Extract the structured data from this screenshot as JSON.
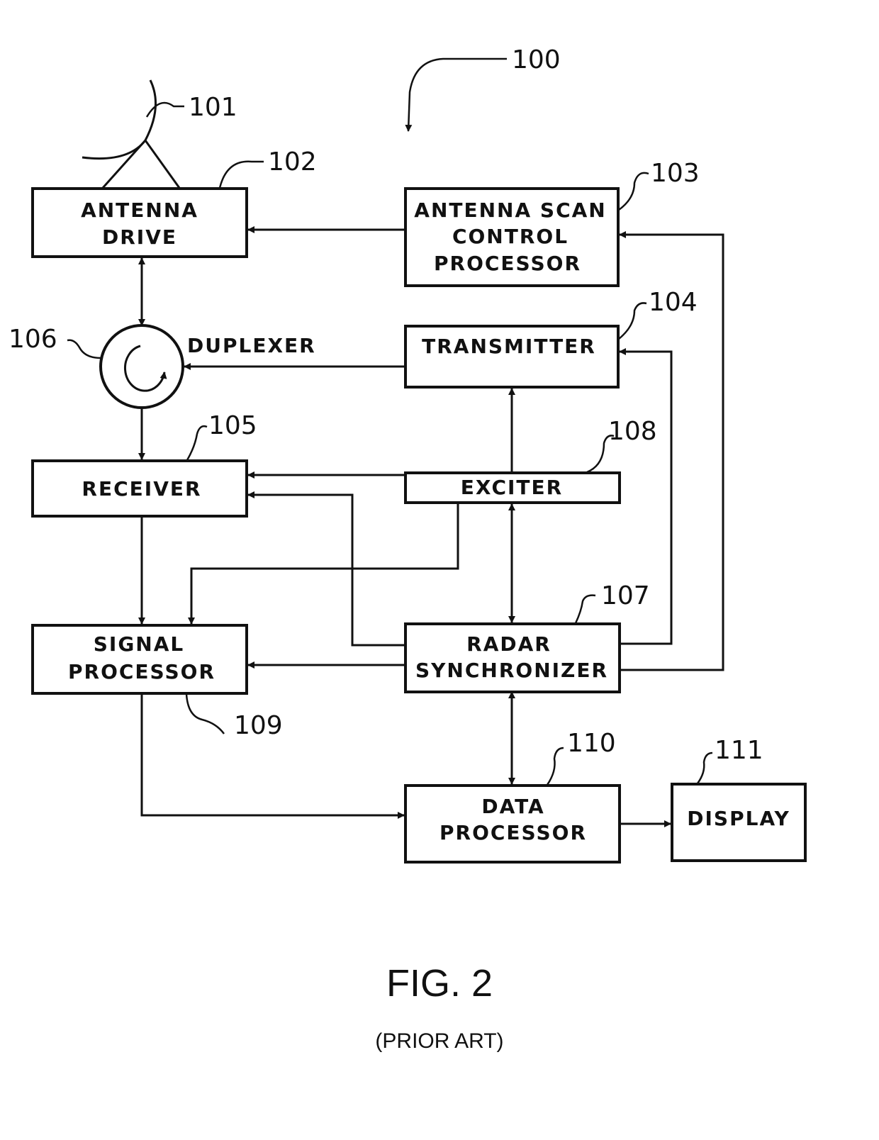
{
  "figure": {
    "title": "FIG. 2",
    "subtitle": "(PRIOR ART)",
    "system_ref": "100"
  },
  "blocks": {
    "antenna_drive": {
      "ref": "102",
      "lines": [
        "ANTENNA",
        "DRIVE"
      ]
    },
    "antenna_scan": {
      "ref": "103",
      "lines": [
        "ANTENNA SCAN",
        "CONTROL",
        "PROCESSOR"
      ]
    },
    "transmitter": {
      "ref": "104",
      "lines": [
        "TRANSMITTER"
      ]
    },
    "receiver": {
      "ref": "105",
      "lines": [
        "RECEIVER"
      ]
    },
    "duplexer": {
      "ref": "106",
      "label": "DUPLEXER"
    },
    "radar_sync": {
      "ref": "107",
      "lines": [
        "RADAR",
        "SYNCHRONIZER"
      ]
    },
    "exciter": {
      "ref": "108",
      "lines": [
        "EXCITER"
      ]
    },
    "signal_processor": {
      "ref": "109",
      "lines": [
        "SIGNAL",
        "PROCESSOR"
      ]
    },
    "data_processor": {
      "ref": "110",
      "lines": [
        "DATA",
        "PROCESSOR"
      ]
    },
    "display": {
      "ref": "111",
      "lines": [
        "DISPLAY"
      ]
    }
  },
  "antenna": {
    "ref": "101"
  },
  "connections": [
    {
      "from": "antenna_scan",
      "to": "antenna_drive"
    },
    {
      "from": "duplexer",
      "to": "antenna_drive",
      "bidirectional": true
    },
    {
      "from": "transmitter",
      "to": "duplexer"
    },
    {
      "from": "duplexer",
      "to": "receiver"
    },
    {
      "from": "exciter",
      "to": "transmitter"
    },
    {
      "from": "exciter",
      "to": "receiver"
    },
    {
      "from": "exciter",
      "to": "signal_processor"
    },
    {
      "from": "radar_sync",
      "to": "exciter",
      "bidirectional": true
    },
    {
      "from": "radar_sync",
      "to": "receiver"
    },
    {
      "from": "radar_sync",
      "to": "transmitter"
    },
    {
      "from": "radar_sync",
      "to": "antenna_scan"
    },
    {
      "from": "radar_sync",
      "to": "signal_processor"
    },
    {
      "from": "receiver",
      "to": "signal_processor"
    },
    {
      "from": "radar_sync",
      "to": "data_processor",
      "bidirectional": true
    },
    {
      "from": "signal_processor",
      "to": "data_processor"
    },
    {
      "from": "data_processor",
      "to": "display"
    }
  ]
}
